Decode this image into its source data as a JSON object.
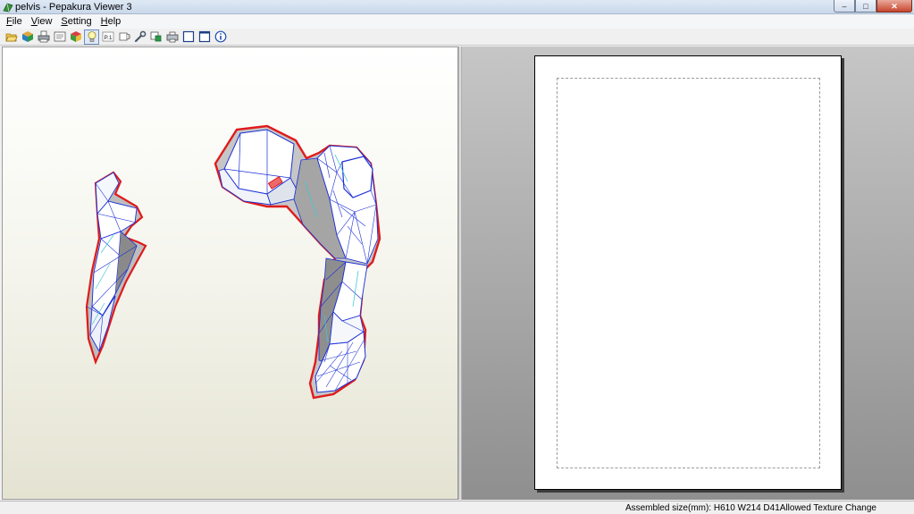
{
  "window": {
    "title": "pelvis - Pepakura Viewer 3",
    "controls": {
      "minimize": "–",
      "maximize": "□",
      "close": "✕"
    }
  },
  "menu": {
    "items": [
      {
        "label": "File",
        "accel": "F"
      },
      {
        "label": "View",
        "accel": "V"
      },
      {
        "label": "Setting",
        "accel": "S"
      },
      {
        "label": "Help",
        "accel": "H"
      }
    ]
  },
  "toolbar": {
    "buttons": [
      {
        "icon": "open-folder-icon"
      },
      {
        "icon": "cube-icon"
      },
      {
        "icon": "print-icon"
      },
      {
        "icon": "print-preview-icon"
      },
      {
        "icon": "texture-cube-icon"
      },
      {
        "icon": "lightbulb-icon"
      },
      {
        "icon": "part-number-icon",
        "text": "P.1"
      },
      {
        "icon": "flap-icon"
      },
      {
        "icon": "wrench-icon"
      },
      {
        "icon": "select-tool-icon"
      },
      {
        "icon": "printer-setup-icon"
      },
      {
        "icon": "single-view-icon"
      },
      {
        "icon": "split-view-icon"
      },
      {
        "icon": "info-icon"
      }
    ]
  },
  "status": {
    "text": "Assembled size(mm): H610 W214 D41Allowed Texture Change"
  },
  "colors": {
    "edge_cut": "#e01b1b",
    "edge_fold": "#1b2fd6",
    "face_light": "#ffffff",
    "face_shade": "#9e9e9e"
  }
}
